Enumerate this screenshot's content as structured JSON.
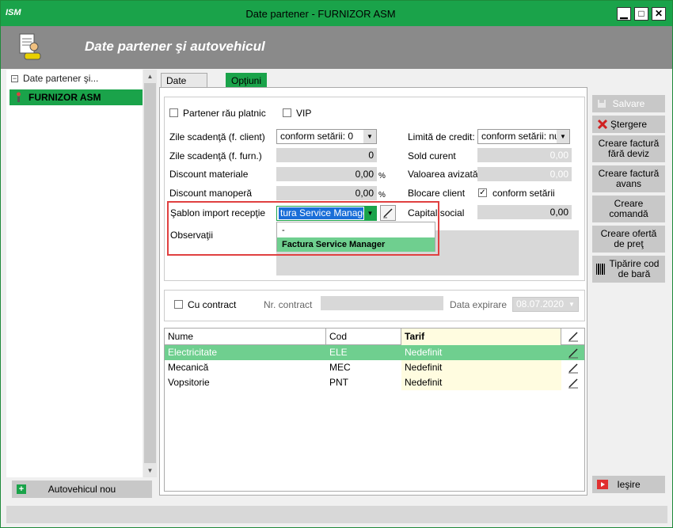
{
  "window": {
    "title": "Date partener - FURNIZOR ASM",
    "logo": "ISM",
    "minimize": "▁",
    "maximize": "□",
    "close": "✕"
  },
  "header": {
    "title": "Date partener şi autovehicul"
  },
  "tree": {
    "root_label": "Date partener şi...",
    "selected_item": "FURNIZOR ASM"
  },
  "left_bottom": {
    "new_vehicle": "Autovehicul nou"
  },
  "tabs": [
    {
      "label": "Date partener",
      "active": false
    },
    {
      "label": "Opţiuni",
      "active": true
    }
  ],
  "options": {
    "bad_payer_label": "Partener rău platnic",
    "bad_payer_checked": false,
    "vip_label": "VIP",
    "vip_checked": false,
    "due_days_client_label": "Zile scadenţă (f. client)",
    "due_days_client_value": "conform setării: 0",
    "due_days_supplier_label": "Zile scadenţă (f. furn.)",
    "due_days_supplier_value": "0",
    "discount_materials_label": "Discount materiale",
    "discount_materials_value": "0,00",
    "discount_labor_label": "Discount manoperă",
    "discount_labor_value": "0,00",
    "pct": "%",
    "template_label": "Şablon import recepţie",
    "template_value": "tura Service Manager",
    "notes_label": "Observaţii",
    "credit_limit_label": "Limită de credit:",
    "credit_limit_value": "conform setării: nu",
    "current_balance_label": "Sold curent",
    "current_balance_value": "0,00",
    "notified_value_label": "Valoarea avizată",
    "notified_value_value": "0,00",
    "block_client_label": "Blocare client",
    "block_client_checked": true,
    "block_client_option": "conform setării",
    "share_capital_label": "Capital social",
    "share_capital_value": "0,00"
  },
  "template_dropdown": {
    "items": [
      "-",
      "Factura Service Manager"
    ],
    "selected_index": 1
  },
  "contract": {
    "with_contract_label": "Cu contract",
    "with_contract_checked": false,
    "contract_no_label": "Nr. contract",
    "contract_no_value": "",
    "expiry_label": "Data expirare",
    "expiry_value": "08.07.2020"
  },
  "grid": {
    "columns": [
      "Nume",
      "Cod",
      "Tarif"
    ],
    "rows": [
      {
        "name": "Electricitate",
        "code": "ELE",
        "tariff": "Nedefinit"
      },
      {
        "name": "Mecanică",
        "code": "MEC",
        "tariff": "Nedefinit"
      },
      {
        "name": "Vopsitorie",
        "code": "PNT",
        "tariff": "Nedefinit"
      }
    ],
    "selected_row": 0
  },
  "actions": {
    "save": "Salvare",
    "delete": "Ştergere",
    "invoice_no_estimate": "Creare factură fără deviz",
    "invoice_advance": "Creare factură avans",
    "create_order": "Creare comandă",
    "price_offer": "Creare ofertă de preţ",
    "print_barcode": "Tipărire cod de bară",
    "exit": "Ieşire"
  },
  "colors": {
    "accent_green": "#1aa34a",
    "light_green": "#6fcf8f",
    "highlight_red": "#e04040",
    "header_gray": "#8a8a8a"
  }
}
